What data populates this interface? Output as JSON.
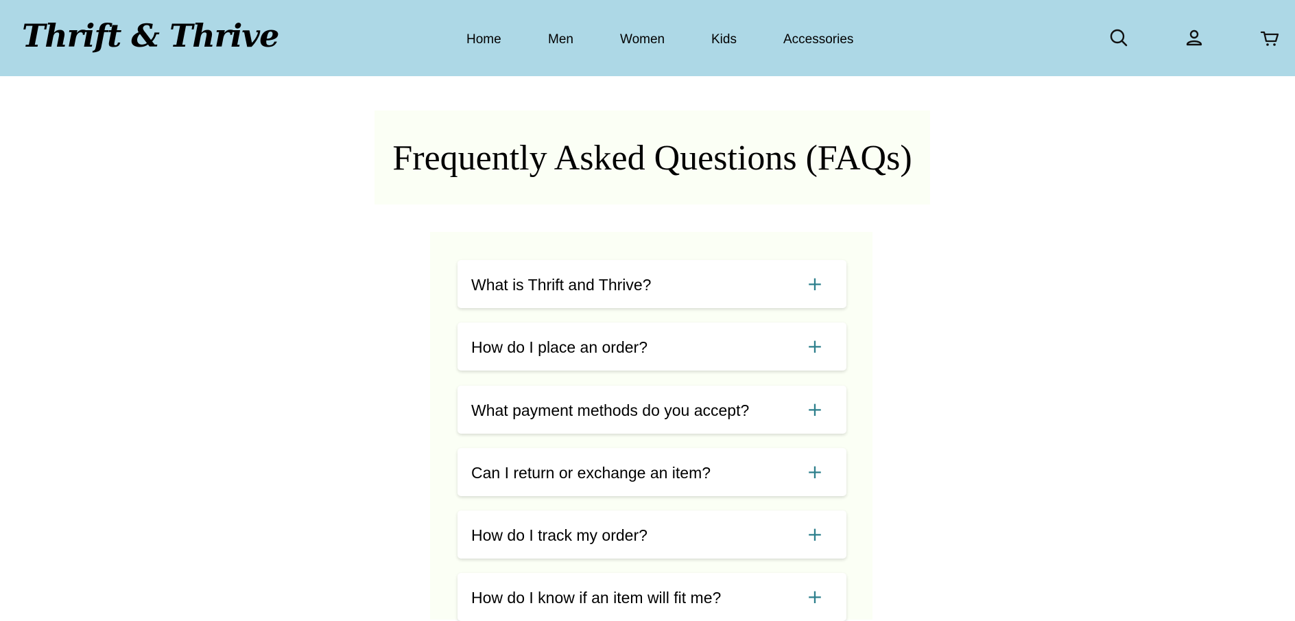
{
  "brand": {
    "logo_text": "Thrift & Thrive"
  },
  "nav": {
    "items": [
      {
        "label": "Home"
      },
      {
        "label": "Men"
      },
      {
        "label": "Women"
      },
      {
        "label": "Kids"
      },
      {
        "label": "Accessories"
      }
    ]
  },
  "header_icons": [
    "search-icon",
    "user-icon",
    "cart-icon"
  ],
  "page": {
    "title": "Frequently Asked Questions (FAQs)"
  },
  "faq": {
    "toggle_symbol": "+",
    "items": [
      {
        "question": "What is Thrift and Thrive?"
      },
      {
        "question": "How do I place an order?"
      },
      {
        "question": "What payment methods do you accept?"
      },
      {
        "question": "Can I return or exchange an item?"
      },
      {
        "question": "How do I track my order?"
      },
      {
        "question": "How do I know if an item will fit me?"
      }
    ]
  },
  "colors": {
    "header_bg": "#add8e6",
    "panel_bg": "#fbfff5",
    "accent": "#2d7f8c"
  }
}
